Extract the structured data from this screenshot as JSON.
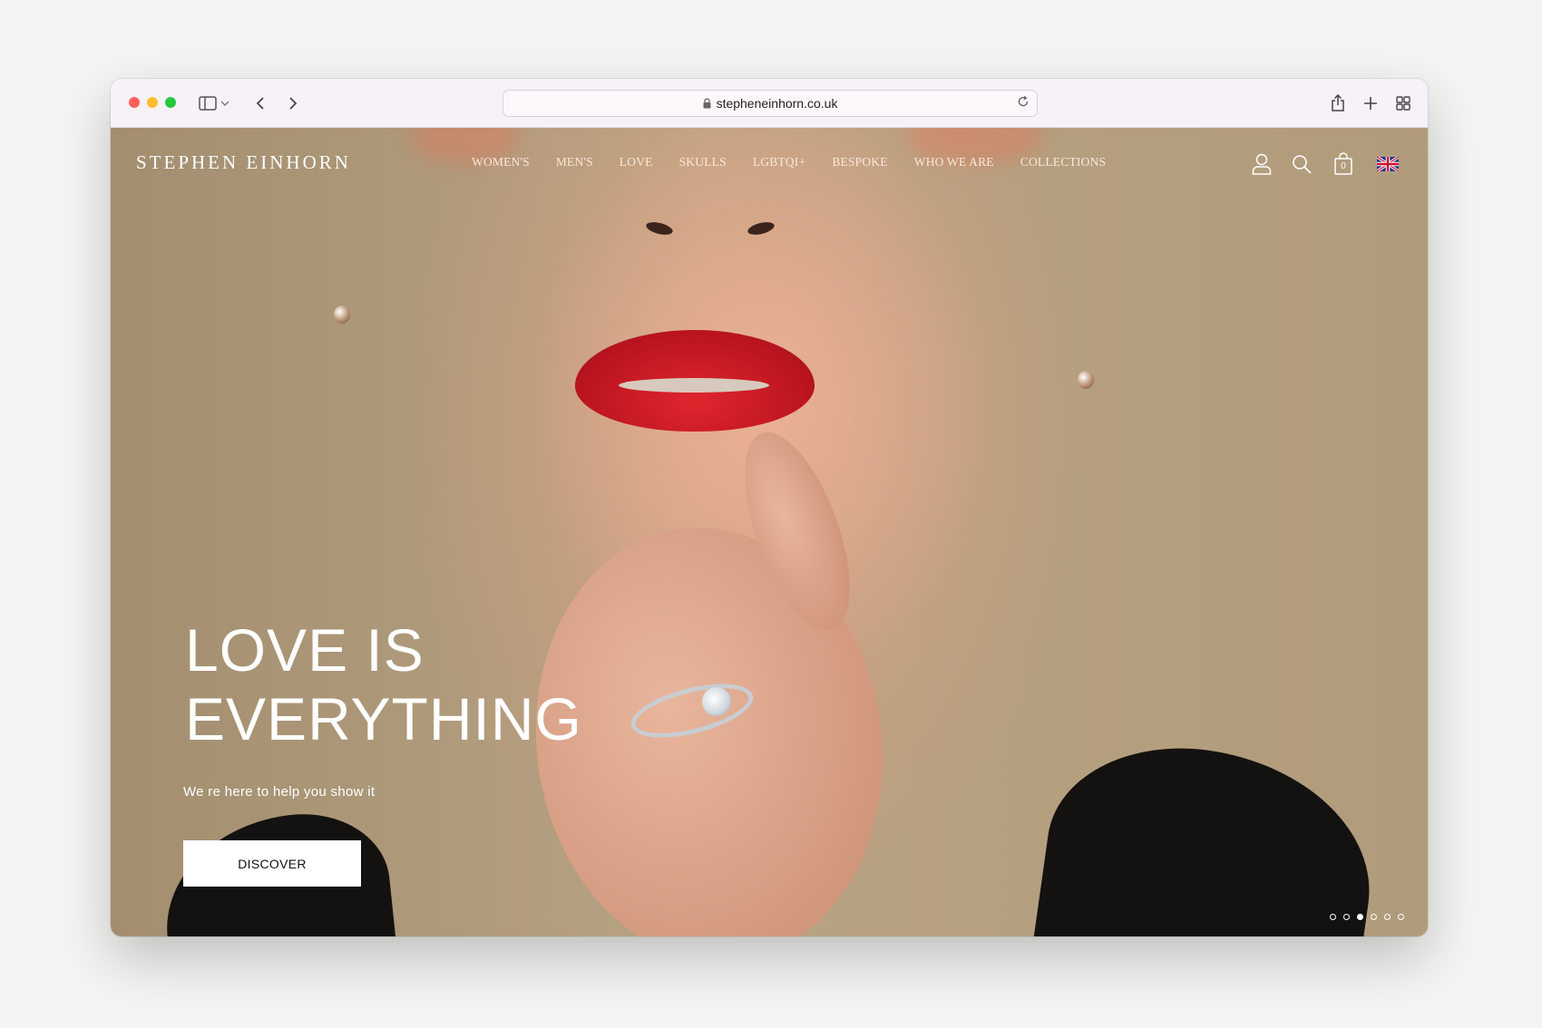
{
  "browser": {
    "url": "stepheneinhorn.co.uk",
    "tab_count_icon": "tab-overview-icon"
  },
  "site": {
    "logo": "STEPHEN EINHORN",
    "menu": [
      "WOMEN'S",
      "MEN'S",
      "LOVE",
      "SKULLS",
      "LGBTQI+",
      "BESPOKE",
      "WHO WE ARE",
      "COLLECTIONS"
    ],
    "cart_count": "0",
    "language": "UK flag"
  },
  "hero": {
    "headline_line1": "LOVE IS",
    "headline_line2": "EVERYTHING",
    "subline": "We re here to help you show it",
    "cta": "DISCOVER",
    "slide_count": 6,
    "active_slide": 3
  }
}
